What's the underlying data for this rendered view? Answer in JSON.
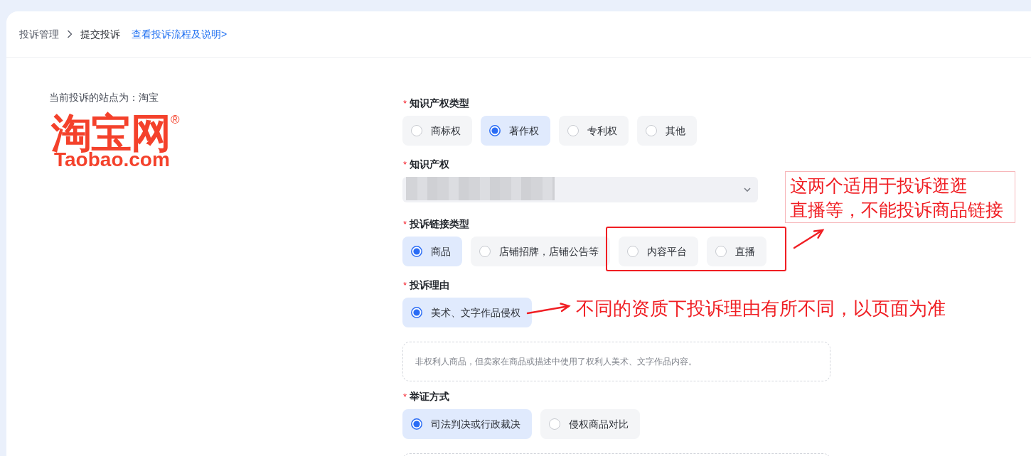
{
  "breadcrumb": {
    "items": [
      {
        "label": "投诉管理",
        "current": false
      },
      {
        "label": "提交投诉",
        "current": true
      }
    ],
    "help_link": "查看投诉流程及说明>"
  },
  "site": {
    "label": "当前投诉的站点为：淘宝",
    "logo": {
      "wordmark": "淘宝网",
      "registered": "®",
      "domain": "Taobao.com"
    }
  },
  "form": {
    "fields": [
      {
        "kind": "radio",
        "required_mark": "*",
        "label": "知识产权类型",
        "options": [
          {
            "label": "商标权",
            "selected": false
          },
          {
            "label": "著作权",
            "selected": true
          },
          {
            "label": "专利权",
            "selected": false
          },
          {
            "label": "其他",
            "selected": false
          }
        ]
      },
      {
        "kind": "select",
        "required_mark": "*",
        "label": "知识产权",
        "redacted": true
      },
      {
        "kind": "radio",
        "required_mark": "*",
        "label": "投诉链接类型",
        "options": [
          {
            "label": "商品",
            "selected": true
          },
          {
            "label": "店铺招牌，店铺公告等",
            "selected": false
          },
          {
            "label": "内容平台",
            "selected": false
          },
          {
            "label": "直播",
            "selected": false
          }
        ]
      },
      {
        "kind": "radio",
        "required_mark": "*",
        "label": "投诉理由",
        "options": [
          {
            "label": "美术、文字作品侵权",
            "selected": true
          }
        ],
        "note_box": true,
        "note": "非权利人商品，但卖家在商品或描述中使用了权利人美术、文字作品内容。"
      },
      {
        "kind": "radio",
        "required_mark": "*",
        "label": "举证方式",
        "options": [
          {
            "label": "司法判决或行政裁决",
            "selected": true
          },
          {
            "label": "侵权商品对比",
            "selected": false
          }
        ],
        "note_box": true
      }
    ]
  },
  "annotations": [
    {
      "kind": "framed_note",
      "lines": [
        "这两个适用于投诉逛逛",
        "直播等，不能投诉商品链接"
      ]
    },
    {
      "kind": "pointer_note",
      "text": "不同的资质下投诉理由有所不同，以页面为准"
    }
  ]
}
